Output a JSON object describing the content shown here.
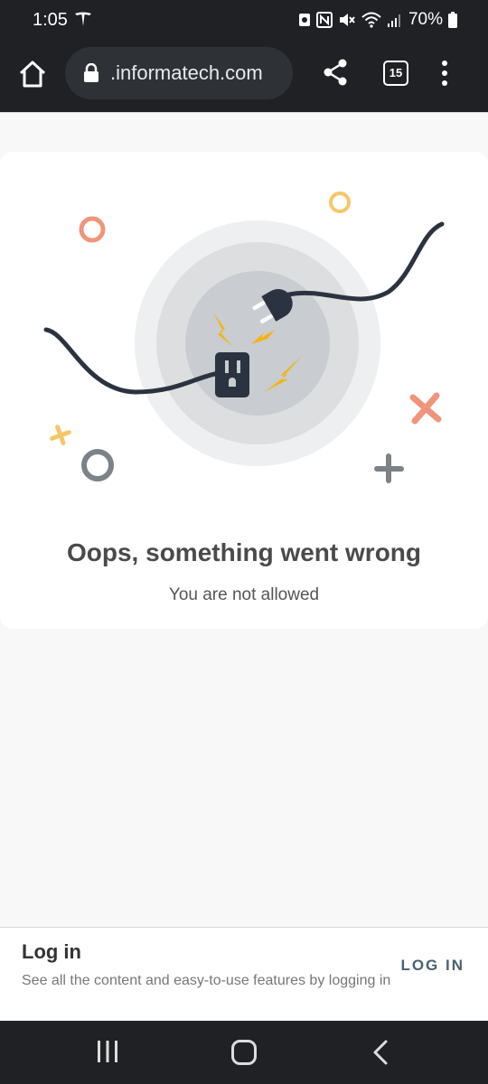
{
  "status_bar": {
    "time": "1:05",
    "battery": "70%",
    "icons": [
      "tesla-icon",
      "nfc-icon",
      "mute-icon",
      "wifi-icon",
      "signal-icon",
      "battery-icon"
    ]
  },
  "browser": {
    "url": ".informatech.com",
    "tab_count": "15",
    "icons": [
      "home-icon",
      "lock-icon",
      "share-icon",
      "tabs-icon",
      "more-menu-icon"
    ]
  },
  "error": {
    "title": "Oops, something went wrong",
    "subtitle": "You are not allowed"
  },
  "login": {
    "title": "Log in",
    "description": "See all the content and easy-to-use features by logging in",
    "button_label": "LOG IN"
  },
  "colors": {
    "chrome_dark": "#202124",
    "url_bar": "#2e3236",
    "accent_orange": "#f0957b",
    "accent_yellow": "#f6b93b",
    "gray_shape": "#7b8288",
    "cord": "#2b3340"
  },
  "nav": {
    "icons": [
      "recent-apps-icon",
      "home-nav-icon",
      "back-icon"
    ]
  }
}
